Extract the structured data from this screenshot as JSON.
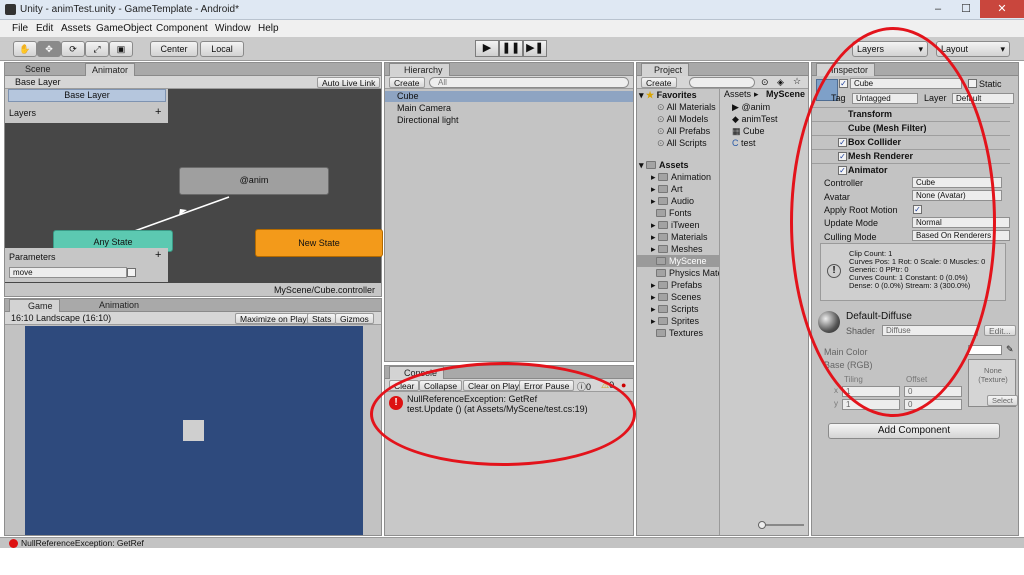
{
  "window": {
    "title": "Unity - animTest.unity - GameTemplate - Android*",
    "min": "–",
    "max": "☐",
    "close": "✕"
  },
  "menu": [
    "File",
    "Edit",
    "Assets",
    "GameObject",
    "Component",
    "Window",
    "Help"
  ],
  "toolbar": {
    "center": "Center",
    "local": "Local",
    "layers": "Layers",
    "layout": "Layout"
  },
  "animator": {
    "tabs": [
      "Scene",
      "Animator"
    ],
    "base_layer_tab": "Base Layer",
    "auto_live_link": "Auto Live Link",
    "base_layer_item": "Base Layer",
    "layers_label": "Layers",
    "parameters_label": "Parameters",
    "param_name": "move",
    "nodes": {
      "anim": "@anim",
      "any": "Any State",
      "new": "New State"
    },
    "path": "MyScene/Cube.controller"
  },
  "game": {
    "tabs": [
      "Game",
      "Animation"
    ],
    "aspect": "16:10 Landscape (16:10)",
    "maximize": "Maximize on Play",
    "stats": "Stats",
    "gizmos": "Gizmos"
  },
  "hierarchy": {
    "tab": "Hierarchy",
    "create": "Create",
    "search_placeholder": "All",
    "items": [
      "Cube",
      "Main Camera",
      "Directional light"
    ]
  },
  "console": {
    "tab": "Console",
    "buttons": [
      "Clear",
      "Collapse",
      "Clear on Play",
      "Error Pause"
    ],
    "counts": [
      "0",
      "0",
      "1"
    ],
    "error_line1": "NullReferenceException: GetRef",
    "error_line2": "test.Update () (at Assets/MyScene/test.cs:19)"
  },
  "project": {
    "tab": "Project",
    "create": "Create",
    "favorites": "Favorites",
    "fav_items": [
      "All Materials",
      "All Models",
      "All Prefabs",
      "All Scripts"
    ],
    "assets": "Assets",
    "asset_folders": [
      "Animation",
      "Art",
      "Audio",
      "Fonts",
      "iTween",
      "Materials",
      "Meshes",
      "MyScene",
      "Physics Materials",
      "Prefabs",
      "Scenes",
      "Scripts",
      "Sprites",
      "Textures"
    ],
    "breadcrumb": [
      "Assets",
      "MyScene"
    ],
    "files": [
      "@anim",
      "animTest",
      "Cube",
      "test"
    ]
  },
  "inspector": {
    "tab": "Inspector",
    "object_name": "Cube",
    "static_label": "Static",
    "tag_label": "Tag",
    "tag_value": "Untagged",
    "layer_label": "Layer",
    "layer_value": "Default",
    "components": [
      "Transform",
      "Cube (Mesh Filter)",
      "Box Collider",
      "Mesh Renderer",
      "Animator"
    ],
    "animator_fields": {
      "controller_label": "Controller",
      "controller_value": "Cube",
      "avatar_label": "Avatar",
      "avatar_value": "None (Avatar)",
      "apply_root_label": "Apply Root Motion",
      "update_mode_label": "Update Mode",
      "update_mode_value": "Normal",
      "culling_label": "Culling Mode",
      "culling_value": "Based On Renderers"
    },
    "info_lines": [
      "Clip Count: 1",
      "Curves Pos: 1 Rot: 0 Scale: 0 Muscles: 0",
      "Generic: 0 PPtr: 0",
      "Curves Count: 1 Constant: 0 (0.0%)",
      "Dense: 0 (0.0%) Stream: 3 (300.0%)"
    ],
    "material": {
      "name": "Default-Diffuse",
      "shader_label": "Shader",
      "shader_value": "Diffuse",
      "edit": "Edit..."
    },
    "main_color": "Main Color",
    "base_rgb": "Base (RGB)",
    "tiling": "Tiling",
    "offset": "Offset",
    "x_label": "x",
    "y_label": "y",
    "tiling_x": "1",
    "tiling_y": "1",
    "offset_x": "0",
    "offset_y": "0",
    "texture_none": "None (Texture)",
    "select": "Select",
    "add_component": "Add Component"
  },
  "statusbar": {
    "message": "NullReferenceException: GetRef"
  },
  "colors": {
    "any_state": "#5cc9b1",
    "new_state": "#f39a1a",
    "game_bg": "#2e4a7d",
    "annotation": "#e3131b"
  }
}
